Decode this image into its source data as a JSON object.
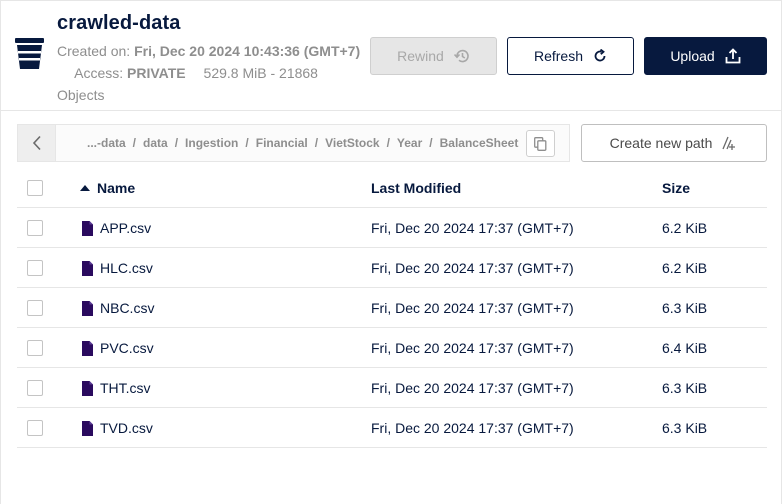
{
  "header": {
    "title": "crawled-data",
    "created_label": "Created on:",
    "created_value": "Fri, Dec 20 2024 10:43:36 (GMT+7)",
    "access_label": "Access:",
    "access_value": "PRIVATE",
    "size": "529.8 MiB",
    "size_sep": "-",
    "objects": "21868 Objects",
    "rewind_label": "Rewind",
    "refresh_label": "Refresh",
    "upload_label": "Upload"
  },
  "breadcrumb": {
    "items": [
      "...-data",
      "data",
      "Ingestion",
      "Financial",
      "VietStock",
      "Year",
      "BalanceSheet"
    ],
    "separator": "/"
  },
  "new_path_label": "Create new path",
  "table": {
    "columns": [
      "Name",
      "Last Modified",
      "Size"
    ],
    "sort": {
      "column": "Name",
      "direction": "ascending"
    },
    "rows": [
      {
        "name": "APP.csv",
        "modified": "Fri, Dec 20 2024 17:37 (GMT+7)",
        "size": "6.2 KiB"
      },
      {
        "name": "HLC.csv",
        "modified": "Fri, Dec 20 2024 17:37 (GMT+7)",
        "size": "6.2 KiB"
      },
      {
        "name": "NBC.csv",
        "modified": "Fri, Dec 20 2024 17:37 (GMT+7)",
        "size": "6.3 KiB"
      },
      {
        "name": "PVC.csv",
        "modified": "Fri, Dec 20 2024 17:37 (GMT+7)",
        "size": "6.4 KiB"
      },
      {
        "name": "THT.csv",
        "modified": "Fri, Dec 20 2024 17:37 (GMT+7)",
        "size": "6.3 KiB"
      },
      {
        "name": "TVD.csv",
        "modified": "Fri, Dec 20 2024 17:37 (GMT+7)",
        "size": "6.3 KiB"
      }
    ]
  },
  "icons": {
    "bucket": "bucket-icon",
    "rewind": "history-icon",
    "refresh": "refresh-icon",
    "upload": "upload-icon",
    "back": "chevron-left-icon",
    "copy": "copy-icon",
    "new_path": "new-path-icon",
    "file": "file-icon",
    "sort": "sort-ascending-icon"
  },
  "colors": {
    "primary": "#07193e",
    "muted_text": "#8e8e8e",
    "disabled_bg": "#e6e6e6",
    "file_icon": "#2a0a5e"
  }
}
